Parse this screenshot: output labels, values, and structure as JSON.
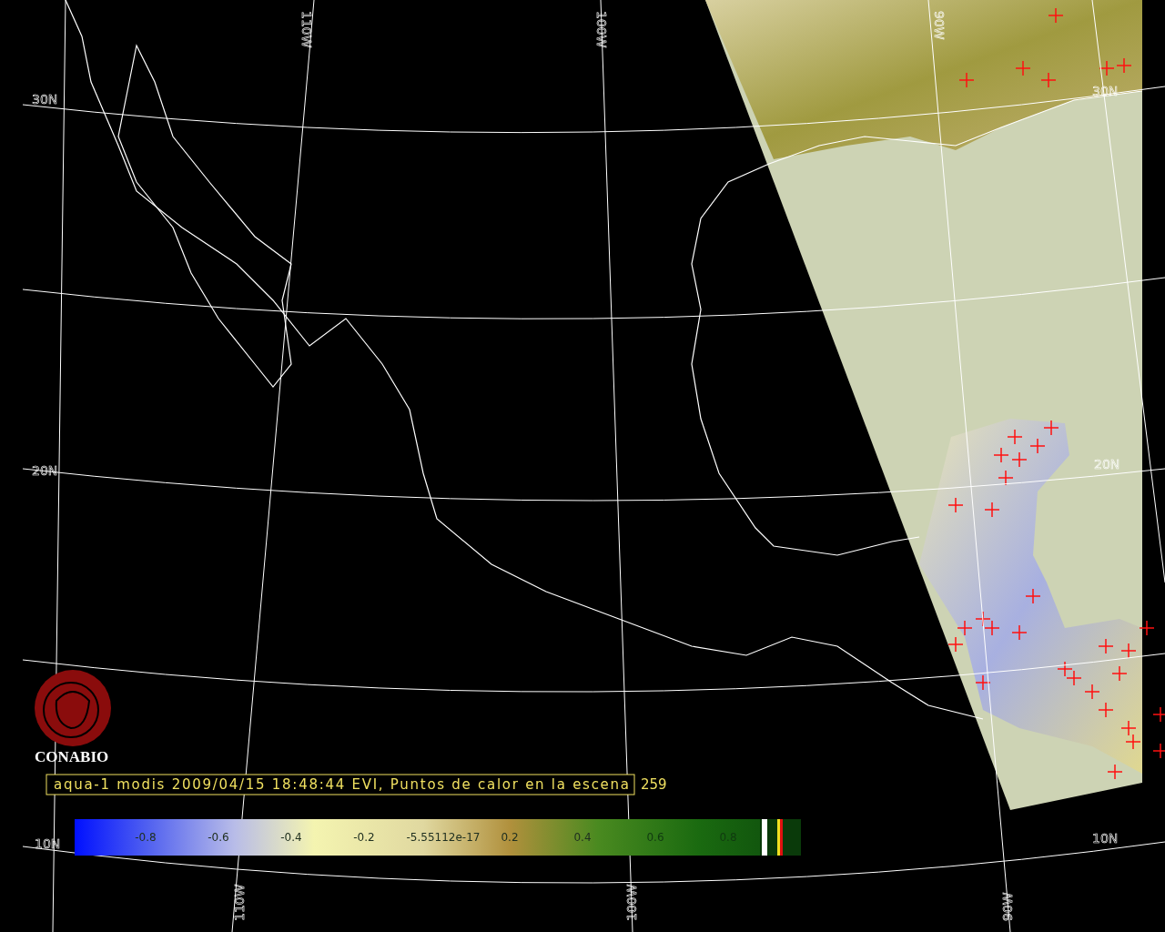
{
  "grid_labels": {
    "left": [
      "30N",
      "20N",
      "10N"
    ],
    "right": [
      "30N",
      "20N",
      "10N"
    ],
    "top": [
      "110W",
      "100W",
      "90W"
    ],
    "bottom": [
      "110W",
      "100W",
      "90W"
    ]
  },
  "logo": {
    "text": "CONABIO"
  },
  "caption": {
    "text": "aqua-1 modis 2009/04/15 18:48:44 EVI, Puntos de calor en la escena",
    "count": "259"
  },
  "colorbar": {
    "ticks": [
      "-0.8",
      "-0.6",
      "-0.4",
      "-0.2",
      "-5.55112e-17",
      "0.2",
      "0.4",
      "0.6",
      "0.8"
    ]
  }
}
